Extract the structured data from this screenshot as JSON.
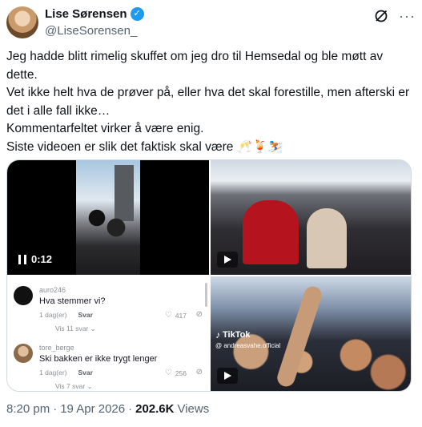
{
  "author": {
    "display_name": "Lise Sørensen",
    "handle": "@LiseSorensen_",
    "verified_icon": "verified-badge-icon"
  },
  "post": {
    "lines": [
      "Jeg hadde blitt rimelig skuffet om jeg dro til Hemsedal og ble møtt av dette.",
      "Vet ikke helt hva de prøver på, eller hva det skal forestille, men afterski er det i alle fall ikke…",
      "Kommentarfeltet virker å være enig.",
      "Siste videoen er slik det faktisk skal være 🥂🍹⛷️"
    ]
  },
  "media": {
    "video_1": {
      "time": "0:12"
    },
    "comments": [
      {
        "user": "auro246",
        "text": "Hva stemmer vi?",
        "time": "1 dag(er)",
        "reply": "Svar",
        "likes": "417",
        "more": "Vis 11 svar"
      },
      {
        "user": "tore_berge",
        "text": "Ski bakken er ikke trygt lenger",
        "time": "1 dag(er)",
        "reply": "Svar",
        "likes": "256",
        "more": "Vis 7 svar"
      }
    ],
    "tiktok": {
      "brand": "TikTok",
      "handle": "@ andreasvahe.official"
    }
  },
  "footer": {
    "time": "8:20 pm",
    "date": "19 Apr 2026",
    "views": "202.6K",
    "views_label": "Views"
  },
  "colors": {
    "accent": "#1d9bf0",
    "text": "#0f1419",
    "muted": "#536471"
  }
}
